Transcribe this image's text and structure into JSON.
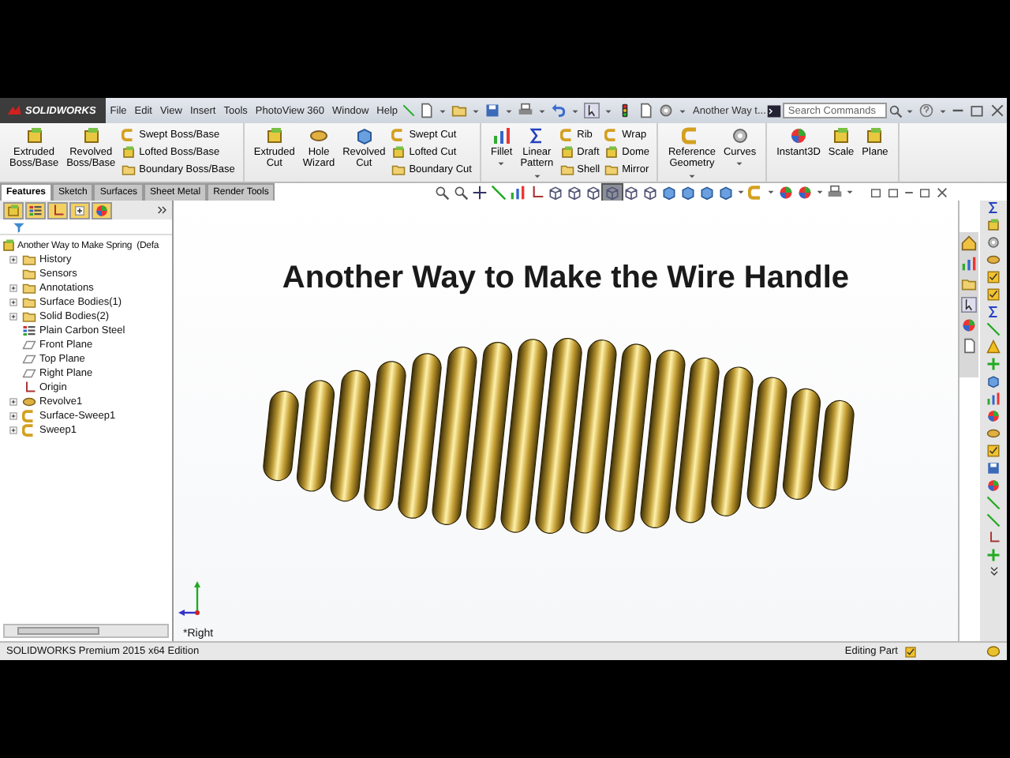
{
  "app": {
    "logo": "SOLIDWORKS",
    "menus": [
      "File",
      "Edit",
      "View",
      "Insert",
      "Tools",
      "PhotoView 360",
      "Window",
      "Help"
    ],
    "document_title": "Another Way t...",
    "search": {
      "placeholder": "Search Commands"
    }
  },
  "ribbon": [
    {
      "items": [
        {
          "kind": "large",
          "label": "Extruded Boss/Base",
          "dropdown": false
        },
        {
          "kind": "large",
          "label": "Revolved Boss/Base",
          "dropdown": false
        },
        {
          "kind": "stack",
          "labels": [
            "Swept Boss/Base",
            "Lofted Boss/Base",
            "Boundary Boss/Base"
          ]
        }
      ]
    },
    {
      "items": [
        {
          "kind": "large",
          "label": "Extruded Cut",
          "dropdown": false
        },
        {
          "kind": "large",
          "label": "Hole Wizard",
          "dropdown": false
        },
        {
          "kind": "large",
          "label": "Revolved Cut",
          "dropdown": false
        },
        {
          "kind": "stack",
          "labels": [
            "Swept Cut",
            "Lofted Cut",
            "Boundary Cut"
          ]
        }
      ]
    },
    {
      "items": [
        {
          "kind": "large",
          "label": "Fillet",
          "dropdown": true
        },
        {
          "kind": "large",
          "label": "Linear Pattern",
          "dropdown": true
        },
        {
          "kind": "stack",
          "labels": [
            "Rib",
            "Draft",
            "Shell"
          ]
        },
        {
          "kind": "stack",
          "labels": [
            "Wrap",
            "Dome",
            "Mirror"
          ]
        }
      ]
    },
    {
      "items": [
        {
          "kind": "large",
          "label": "Reference Geometry",
          "dropdown": true
        },
        {
          "kind": "large",
          "label": "Curves",
          "dropdown": true
        }
      ]
    },
    {
      "items": [
        {
          "kind": "large",
          "label": "Instant3D",
          "dropdown": false
        },
        {
          "kind": "large",
          "label": "Scale",
          "dropdown": false
        },
        {
          "kind": "large",
          "label": "Plane",
          "dropdown": false
        }
      ]
    }
  ],
  "tabs": [
    {
      "label": "Features",
      "selected": true
    },
    {
      "label": "Sketch",
      "selected": false
    },
    {
      "label": "Surfaces",
      "selected": false
    },
    {
      "label": "Sheet Metal",
      "selected": false
    },
    {
      "label": "Render Tools",
      "selected": false
    }
  ],
  "feature_tree": {
    "root": "Another Way to Make Spring  (Defa",
    "items": [
      {
        "label": "History",
        "kind": "folder",
        "expandable": true
      },
      {
        "label": "Sensors",
        "kind": "folder",
        "expandable": false
      },
      {
        "label": "Annotations",
        "kind": "folder",
        "expandable": true
      },
      {
        "label": "Surface Bodies(1)",
        "kind": "folder",
        "expandable": true
      },
      {
        "label": "Solid Bodies(2)",
        "kind": "folder",
        "expandable": true
      },
      {
        "label": "Plain Carbon Steel",
        "kind": "material",
        "expandable": false
      },
      {
        "label": "Front Plane",
        "kind": "plane",
        "expandable": false
      },
      {
        "label": "Top Plane",
        "kind": "plane",
        "expandable": false
      },
      {
        "label": "Right Plane",
        "kind": "plane",
        "expandable": false
      },
      {
        "label": "Origin",
        "kind": "origin",
        "expandable": false
      },
      {
        "label": "Revolve1",
        "kind": "feature",
        "expandable": true
      },
      {
        "label": "Surface-Sweep1",
        "kind": "sweep",
        "expandable": true
      },
      {
        "label": "Sweep1",
        "kind": "sweep",
        "expandable": true
      }
    ]
  },
  "graphics": {
    "title": "Another Way to Make the Wire Handle",
    "view_name": "*Right"
  },
  "status_bar": {
    "product": "SOLIDWORKS Premium 2015 x64 Edition",
    "mode": "Editing Part"
  }
}
